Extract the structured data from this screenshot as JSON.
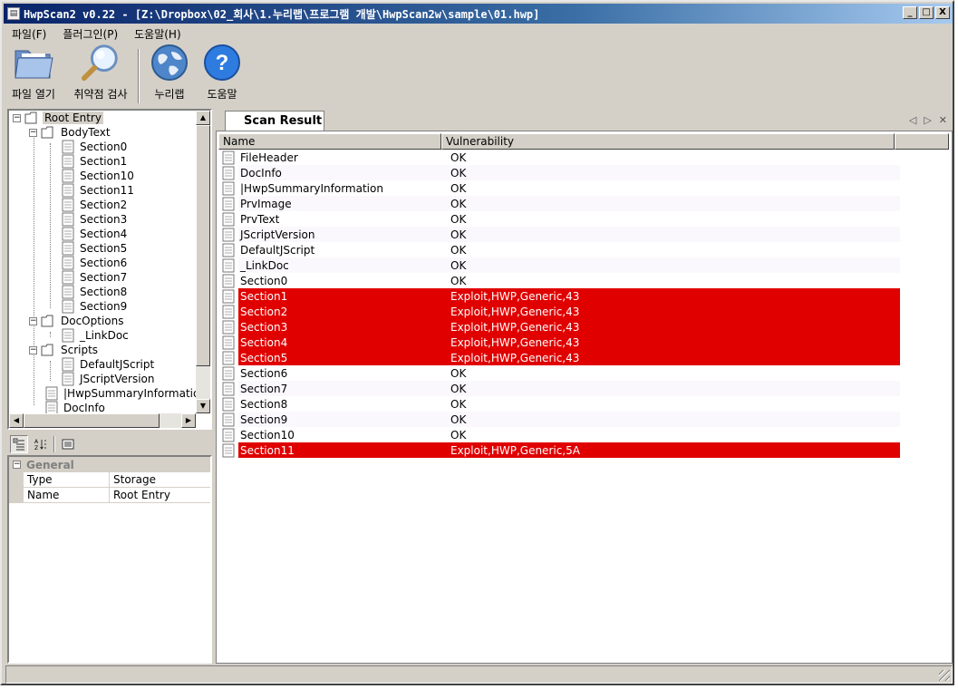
{
  "window": {
    "title": "HwpScan2 v0.22 - [Z:\\Dropbox\\02_회사\\1.누리랩\\프로그램 개발\\HwpScan2w\\sample\\01.hwp]",
    "controls": {
      "minimize": "_",
      "restore": "□",
      "close": "X"
    }
  },
  "menu": [
    "파일(F)",
    "플러그인(P)",
    "도움말(H)"
  ],
  "toolbar": {
    "open": "파일 열기",
    "scan": "취약점 검사",
    "nurilab": "누리랩",
    "help": "도움말"
  },
  "tree": {
    "root": "Root Entry",
    "body_text": "BodyText",
    "sections": [
      "Section0",
      "Section1",
      "Section10",
      "Section11",
      "Section2",
      "Section3",
      "Section4",
      "Section5",
      "Section6",
      "Section7",
      "Section8",
      "Section9"
    ],
    "doc_options": "DocOptions",
    "link_doc": "_LinkDoc",
    "scripts": "Scripts",
    "default_jscript": "DefaultJScript",
    "jscript_version": "JScriptVersion",
    "summary": "|HwpSummaryInformation",
    "doc_info": "DocInfo"
  },
  "properties": {
    "category": "General",
    "rows": [
      {
        "key": "Type",
        "value": "Storage"
      },
      {
        "key": "Name",
        "value": "Root Entry"
      }
    ]
  },
  "result": {
    "tab": "Scan Result",
    "columns": [
      "Name",
      "Vulnerability"
    ],
    "rows": [
      {
        "name": "FileHeader",
        "vuln": "OK",
        "status": "ok"
      },
      {
        "name": "DocInfo",
        "vuln": "OK",
        "status": "ok"
      },
      {
        "name": "|HwpSummaryInformation",
        "vuln": "OK",
        "status": "ok"
      },
      {
        "name": "PrvImage",
        "vuln": "OK",
        "status": "ok"
      },
      {
        "name": "PrvText",
        "vuln": "OK",
        "status": "ok"
      },
      {
        "name": "JScriptVersion",
        "vuln": "OK",
        "status": "ok"
      },
      {
        "name": "DefaultJScript",
        "vuln": "OK",
        "status": "ok"
      },
      {
        "name": "_LinkDoc",
        "vuln": "OK",
        "status": "ok"
      },
      {
        "name": "Section0",
        "vuln": "OK",
        "status": "ok"
      },
      {
        "name": "Section1",
        "vuln": "Exploit,HWP,Generic,43",
        "status": "vuln"
      },
      {
        "name": "Section2",
        "vuln": "Exploit,HWP,Generic,43",
        "status": "vuln"
      },
      {
        "name": "Section3",
        "vuln": "Exploit,HWP,Generic,43",
        "status": "vuln"
      },
      {
        "name": "Section4",
        "vuln": "Exploit,HWP,Generic,43",
        "status": "vuln"
      },
      {
        "name": "Section5",
        "vuln": "Exploit,HWP,Generic,43",
        "status": "vuln"
      },
      {
        "name": "Section6",
        "vuln": "OK",
        "status": "ok"
      },
      {
        "name": "Section7",
        "vuln": "OK",
        "status": "ok"
      },
      {
        "name": "Section8",
        "vuln": "OK",
        "status": "ok"
      },
      {
        "name": "Section9",
        "vuln": "OK",
        "status": "ok"
      },
      {
        "name": "Section10",
        "vuln": "OK",
        "status": "ok"
      },
      {
        "name": "Section11",
        "vuln": "Exploit,HWP,Generic,5A",
        "status": "vuln"
      }
    ]
  },
  "colors": {
    "vulnerable_row": "#e00000",
    "title_bar": "#0a246a"
  }
}
